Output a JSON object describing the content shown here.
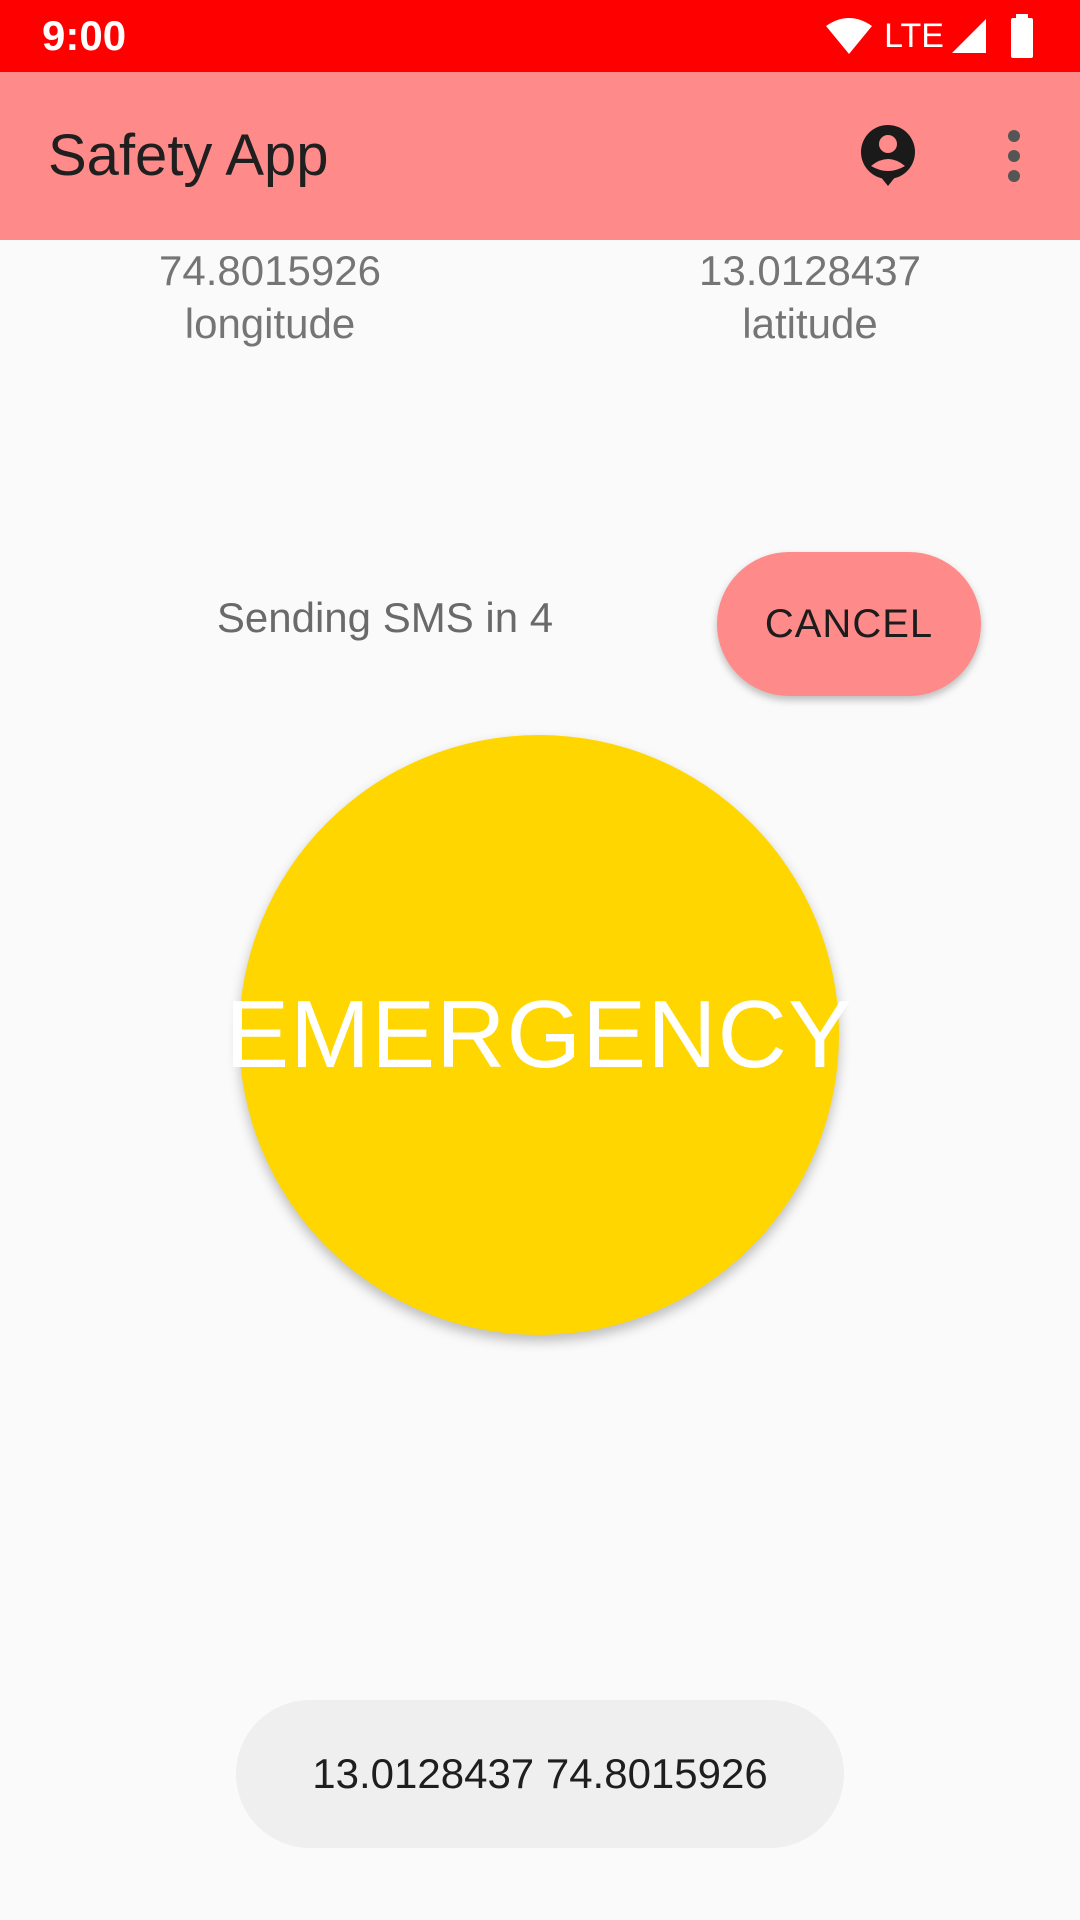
{
  "status_bar": {
    "time": "9:00",
    "network": "LTE",
    "icons": [
      "wifi-icon",
      "signal-icon",
      "battery-icon"
    ],
    "color": "#ff0000"
  },
  "app_bar": {
    "title": "Safety App",
    "color": "#ff8a8a",
    "actions": [
      "account-icon",
      "more-vert-icon"
    ]
  },
  "location": {
    "longitude_value": "74.8015926",
    "longitude_label": "longitude",
    "latitude_value": "13.0128437",
    "latitude_label": "latitude"
  },
  "countdown_text": "Sending SMS in 4",
  "cancel_label": "CANCEL",
  "emergency": {
    "label": "EMERGENCY",
    "color": "#ffd600"
  },
  "toast_text": "13.0128437 74.8015926"
}
